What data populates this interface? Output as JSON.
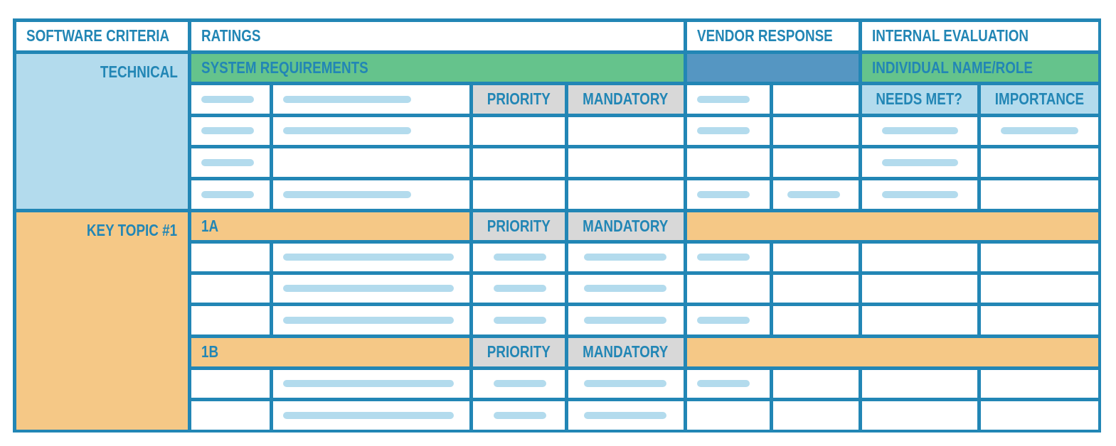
{
  "colors": {
    "border": "#2286b5",
    "text": "#2286b5",
    "light_blue": "#b3dbed",
    "green": "#65c38c",
    "steel_blue": "#5596c2",
    "orange": "#f5c886",
    "gray": "#d8d8d8"
  },
  "header": {
    "software_criteria": "SOFTWARE CRITERIA",
    "ratings": "RATINGS",
    "vendor_response": "VENDOR RESPONSE",
    "internal_evaluation": "INTERNAL EVALUATION"
  },
  "technical": {
    "label": "TECHNICAL",
    "system_requirements": "SYSTEM REQUIREMENTS",
    "individual": "INDIVIDUAL NAME/ROLE",
    "priority": "PRIORITY",
    "mandatory": "MANDATORY",
    "needs_met": "NEEDS MET?",
    "importance": "IMPORTANCE"
  },
  "key_topic": {
    "label": "KEY TOPIC #1",
    "sections": [
      {
        "label": "1A",
        "priority": "PRIORITY",
        "mandatory": "MANDATORY"
      },
      {
        "label": "1B",
        "priority": "PRIORITY",
        "mandatory": "MANDATORY"
      }
    ]
  }
}
